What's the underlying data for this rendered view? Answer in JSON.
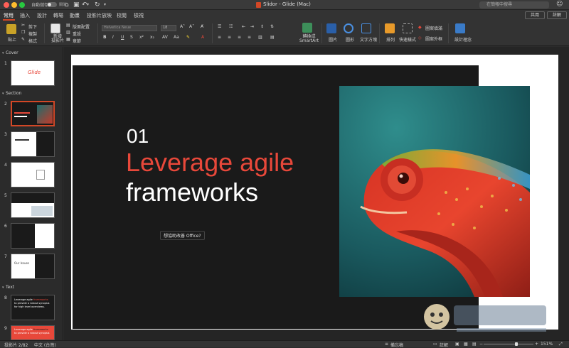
{
  "titlebar": {
    "autosave_label": "自動儲存",
    "toggle_label": "關閉",
    "document_title": "Slidor - Glide (Mac)",
    "search_placeholder": "在簡報中搜尋"
  },
  "tabs": [
    "常用",
    "插入",
    "設計",
    "轉場",
    "動畫",
    "投影片放映",
    "校閱",
    "檢視"
  ],
  "active_tab": "常用",
  "share_label": "共用",
  "comment_label": "註解",
  "ribbon": {
    "paste": "貼上",
    "cut": "剪下",
    "copy": "複製",
    "format": "格式",
    "new_slide": "新增\n投影片",
    "layout": "版面配置",
    "reset": "重設",
    "section": "章節",
    "font_name": "Helvetica Neue",
    "font_size": "18",
    "convert_smartart": "轉換成\nSmartArt",
    "picture": "圖片",
    "shapes": "圖形",
    "text_box": "文字方塊",
    "arrange": "排列",
    "quick_styles": "快速樣式",
    "shape_fill": "圖案填滿",
    "shape_outline": "圖案外框",
    "design_ideas": "設計理念"
  },
  "sidebar": {
    "sections": [
      "Cover",
      "Section",
      "Text"
    ],
    "slide_numbers": [
      "1",
      "2",
      "3",
      "4",
      "5",
      "6",
      "7",
      "8",
      "9"
    ],
    "thumb_texts": {
      "s1": "Glide",
      "s7": "Our Issues",
      "s8a": "Leverage agile",
      "s8b": "frameworks",
      "s8c": "to provide a robust synopsis",
      "s8d": "for high level overviews.",
      "s9a": "Leverage agile",
      "s9b": "frameworks",
      "s9c": "to provide a robust synopsis"
    }
  },
  "slide": {
    "number": "01",
    "line1": "Leverage agile",
    "line2": "frameworks"
  },
  "tooltip": "想協助改善 Office?",
  "status": {
    "slide_info": "投影片 2/82",
    "language": "中文 (台灣)",
    "notes": "備忘稿",
    "comments": "註解",
    "zoom": "151%"
  },
  "colors": {
    "accent": "#d24726",
    "headline_red": "#e8483a",
    "slide_dark": "#1a1a1a"
  }
}
